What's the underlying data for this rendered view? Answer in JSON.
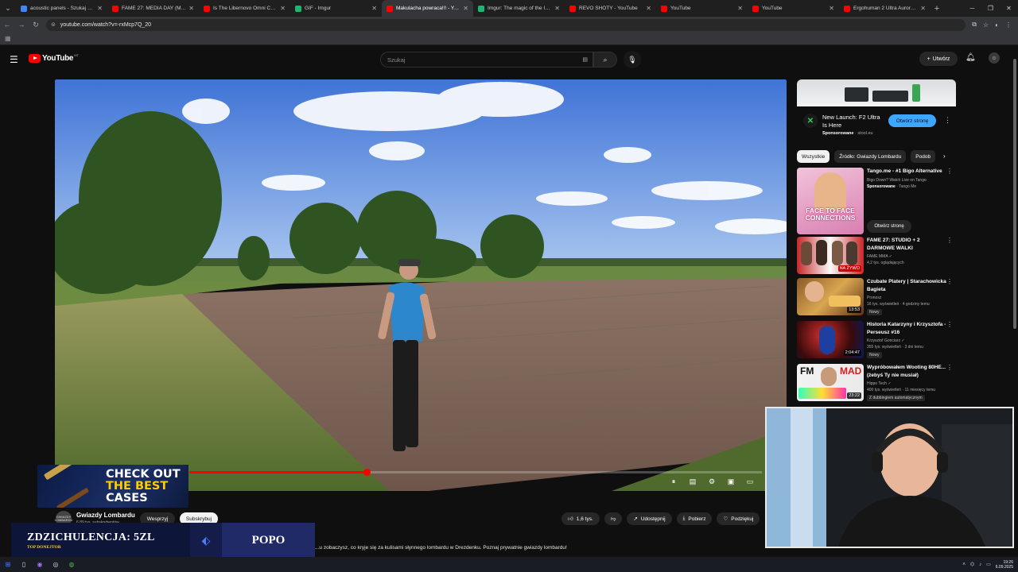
{
  "browser": {
    "tabs": [
      {
        "title": "acoustic panels - Szukaj w Go...",
        "color": "#4285f4"
      },
      {
        "title": "FAME 27: MEDIA DAY (Media...",
        "color": "#ff0000"
      },
      {
        "title": "Is The Libernovo Omni Chair...",
        "color": "#ff0000"
      },
      {
        "title": "GIF - Imgur",
        "color": "#1bb76e"
      },
      {
        "title": "Makulacha powraca!!! - Yo...",
        "color": "#ff0000",
        "active": true
      },
      {
        "title": "Imgur: The magic of the Inter...",
        "color": "#1bb76e"
      },
      {
        "title": "REVO SHOTY - YouTube",
        "color": "#ff0000"
      },
      {
        "title": "YouTube",
        "color": "#ff0000"
      },
      {
        "title": "YouTube",
        "color": "#ff0000"
      },
      {
        "title": "Ergohuman 2 Ultra Aurora W...",
        "color": "#ff0000"
      }
    ],
    "url": "youtube.com/watch?v=-rxMcp7Q_20"
  },
  "header": {
    "logo_text": "YouTube",
    "region": "MT",
    "search_placeholder": "Szukaj",
    "create_label": "Utwórz"
  },
  "player": {
    "progress_fraction": 0.31,
    "promo_line1": "CHECK OUT",
    "promo_line2": "THE BEST",
    "promo_line3": "CASES"
  },
  "channel": {
    "avatar_text": "GWIAZDY LOMBARDU",
    "name": "Gwiazdy Lombardu",
    "subs": "6,89 tys. subskrybentów",
    "join_label": "Wesprzyj",
    "subscribe_label": "Subskrybuj"
  },
  "actions": {
    "likes": "1,6 tys.",
    "share": "Udostępnij",
    "download": "Pobierz",
    "thanks": "Podziękuj"
  },
  "description_snippet": "...u zobaczysz, co kryje się za kulisami słynnego lombardu w Drezdenku. Poznaj prywatnie gwiazdy lombardu!",
  "donation": {
    "text": "ZDZICHULENCJA: 5ZL",
    "sub": "TOP DONEJTOR",
    "name": "POPO"
  },
  "ad": {
    "title": "New Launch: F2 Ultra Is Here",
    "sponsored": "Sponsorowane",
    "domain": "stool.eu",
    "cta": "Otwórz stronę"
  },
  "chips": [
    "Wszystkie",
    "Źródło: Gwiazdy Lombardu",
    "Podob"
  ],
  "recommendations": [
    {
      "title": "Tango.me - #1 Bigo Alternative",
      "line1": "Bigo Down? Watch Live on Tango",
      "sponsored": "Sponsorowane",
      "advertiser": "Tango Me",
      "cta": "Otwórz stronę",
      "thumb_text": "FACE TO FACE CONNECTIONS"
    },
    {
      "title": "FAME 27: STUDIO + 2 DARMOWE WALKI",
      "channel": "FAME MMA",
      "meta": "4,2 tys. oglądających",
      "thumb_text": "NA ŻYWO"
    },
    {
      "title": "Czubate Platery | Starachowicka Bagieta",
      "channel": "Pronosz",
      "meta": "16 tys. wyświetleń · 4 godziny temu",
      "badge": "Nowy",
      "duration": "13:53"
    },
    {
      "title": "Historia Katarzyny i Krzysztofa - Perseusz #16",
      "channel": "Krzysztof Gonciarz",
      "meta": "355 tys. wyświetleń · 3 dni temu",
      "badge": "Nowy",
      "duration": "2:04:47"
    },
    {
      "title": "Wypróbowałem Wooting 80HE... (żebyś Ty nie musiał)",
      "channel": "Hippo Tech",
      "meta": "400 tys. wyświetleń · 11 miesięcy temu",
      "badge": "Z dubbingiem automatycznym",
      "duration": "23:22",
      "thumb_text": "MAD"
    }
  ],
  "taskbar": {
    "time": "19:26",
    "date": "6.09.2025"
  }
}
